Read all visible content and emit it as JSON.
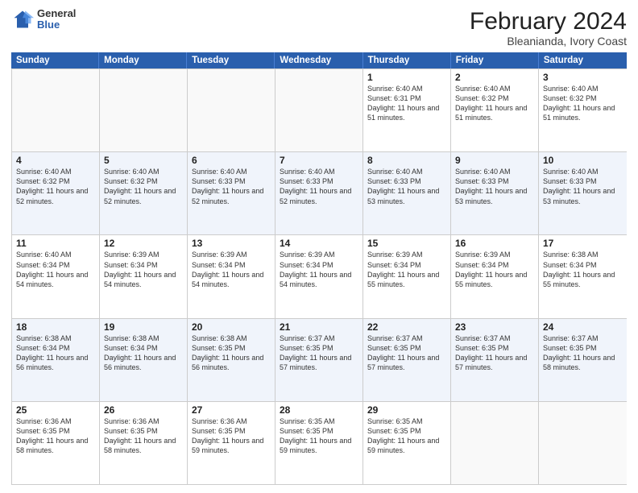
{
  "header": {
    "logo_general": "General",
    "logo_blue": "Blue",
    "title": "February 2024",
    "subtitle": "Bleanianda, Ivory Coast"
  },
  "days_of_week": [
    "Sunday",
    "Monday",
    "Tuesday",
    "Wednesday",
    "Thursday",
    "Friday",
    "Saturday"
  ],
  "weeks": [
    [
      {
        "day": "",
        "info": ""
      },
      {
        "day": "",
        "info": ""
      },
      {
        "day": "",
        "info": ""
      },
      {
        "day": "",
        "info": ""
      },
      {
        "day": "1",
        "info": "Sunrise: 6:40 AM\nSunset: 6:31 PM\nDaylight: 11 hours and 51 minutes."
      },
      {
        "day": "2",
        "info": "Sunrise: 6:40 AM\nSunset: 6:32 PM\nDaylight: 11 hours and 51 minutes."
      },
      {
        "day": "3",
        "info": "Sunrise: 6:40 AM\nSunset: 6:32 PM\nDaylight: 11 hours and 51 minutes."
      }
    ],
    [
      {
        "day": "4",
        "info": "Sunrise: 6:40 AM\nSunset: 6:32 PM\nDaylight: 11 hours and 52 minutes."
      },
      {
        "day": "5",
        "info": "Sunrise: 6:40 AM\nSunset: 6:32 PM\nDaylight: 11 hours and 52 minutes."
      },
      {
        "day": "6",
        "info": "Sunrise: 6:40 AM\nSunset: 6:33 PM\nDaylight: 11 hours and 52 minutes."
      },
      {
        "day": "7",
        "info": "Sunrise: 6:40 AM\nSunset: 6:33 PM\nDaylight: 11 hours and 52 minutes."
      },
      {
        "day": "8",
        "info": "Sunrise: 6:40 AM\nSunset: 6:33 PM\nDaylight: 11 hours and 53 minutes."
      },
      {
        "day": "9",
        "info": "Sunrise: 6:40 AM\nSunset: 6:33 PM\nDaylight: 11 hours and 53 minutes."
      },
      {
        "day": "10",
        "info": "Sunrise: 6:40 AM\nSunset: 6:33 PM\nDaylight: 11 hours and 53 minutes."
      }
    ],
    [
      {
        "day": "11",
        "info": "Sunrise: 6:40 AM\nSunset: 6:34 PM\nDaylight: 11 hours and 54 minutes."
      },
      {
        "day": "12",
        "info": "Sunrise: 6:39 AM\nSunset: 6:34 PM\nDaylight: 11 hours and 54 minutes."
      },
      {
        "day": "13",
        "info": "Sunrise: 6:39 AM\nSunset: 6:34 PM\nDaylight: 11 hours and 54 minutes."
      },
      {
        "day": "14",
        "info": "Sunrise: 6:39 AM\nSunset: 6:34 PM\nDaylight: 11 hours and 54 minutes."
      },
      {
        "day": "15",
        "info": "Sunrise: 6:39 AM\nSunset: 6:34 PM\nDaylight: 11 hours and 55 minutes."
      },
      {
        "day": "16",
        "info": "Sunrise: 6:39 AM\nSunset: 6:34 PM\nDaylight: 11 hours and 55 minutes."
      },
      {
        "day": "17",
        "info": "Sunrise: 6:38 AM\nSunset: 6:34 PM\nDaylight: 11 hours and 55 minutes."
      }
    ],
    [
      {
        "day": "18",
        "info": "Sunrise: 6:38 AM\nSunset: 6:34 PM\nDaylight: 11 hours and 56 minutes."
      },
      {
        "day": "19",
        "info": "Sunrise: 6:38 AM\nSunset: 6:34 PM\nDaylight: 11 hours and 56 minutes."
      },
      {
        "day": "20",
        "info": "Sunrise: 6:38 AM\nSunset: 6:35 PM\nDaylight: 11 hours and 56 minutes."
      },
      {
        "day": "21",
        "info": "Sunrise: 6:37 AM\nSunset: 6:35 PM\nDaylight: 11 hours and 57 minutes."
      },
      {
        "day": "22",
        "info": "Sunrise: 6:37 AM\nSunset: 6:35 PM\nDaylight: 11 hours and 57 minutes."
      },
      {
        "day": "23",
        "info": "Sunrise: 6:37 AM\nSunset: 6:35 PM\nDaylight: 11 hours and 57 minutes."
      },
      {
        "day": "24",
        "info": "Sunrise: 6:37 AM\nSunset: 6:35 PM\nDaylight: 11 hours and 58 minutes."
      }
    ],
    [
      {
        "day": "25",
        "info": "Sunrise: 6:36 AM\nSunset: 6:35 PM\nDaylight: 11 hours and 58 minutes."
      },
      {
        "day": "26",
        "info": "Sunrise: 6:36 AM\nSunset: 6:35 PM\nDaylight: 11 hours and 58 minutes."
      },
      {
        "day": "27",
        "info": "Sunrise: 6:36 AM\nSunset: 6:35 PM\nDaylight: 11 hours and 59 minutes."
      },
      {
        "day": "28",
        "info": "Sunrise: 6:35 AM\nSunset: 6:35 PM\nDaylight: 11 hours and 59 minutes."
      },
      {
        "day": "29",
        "info": "Sunrise: 6:35 AM\nSunset: 6:35 PM\nDaylight: 11 hours and 59 minutes."
      },
      {
        "day": "",
        "info": ""
      },
      {
        "day": "",
        "info": ""
      }
    ]
  ]
}
